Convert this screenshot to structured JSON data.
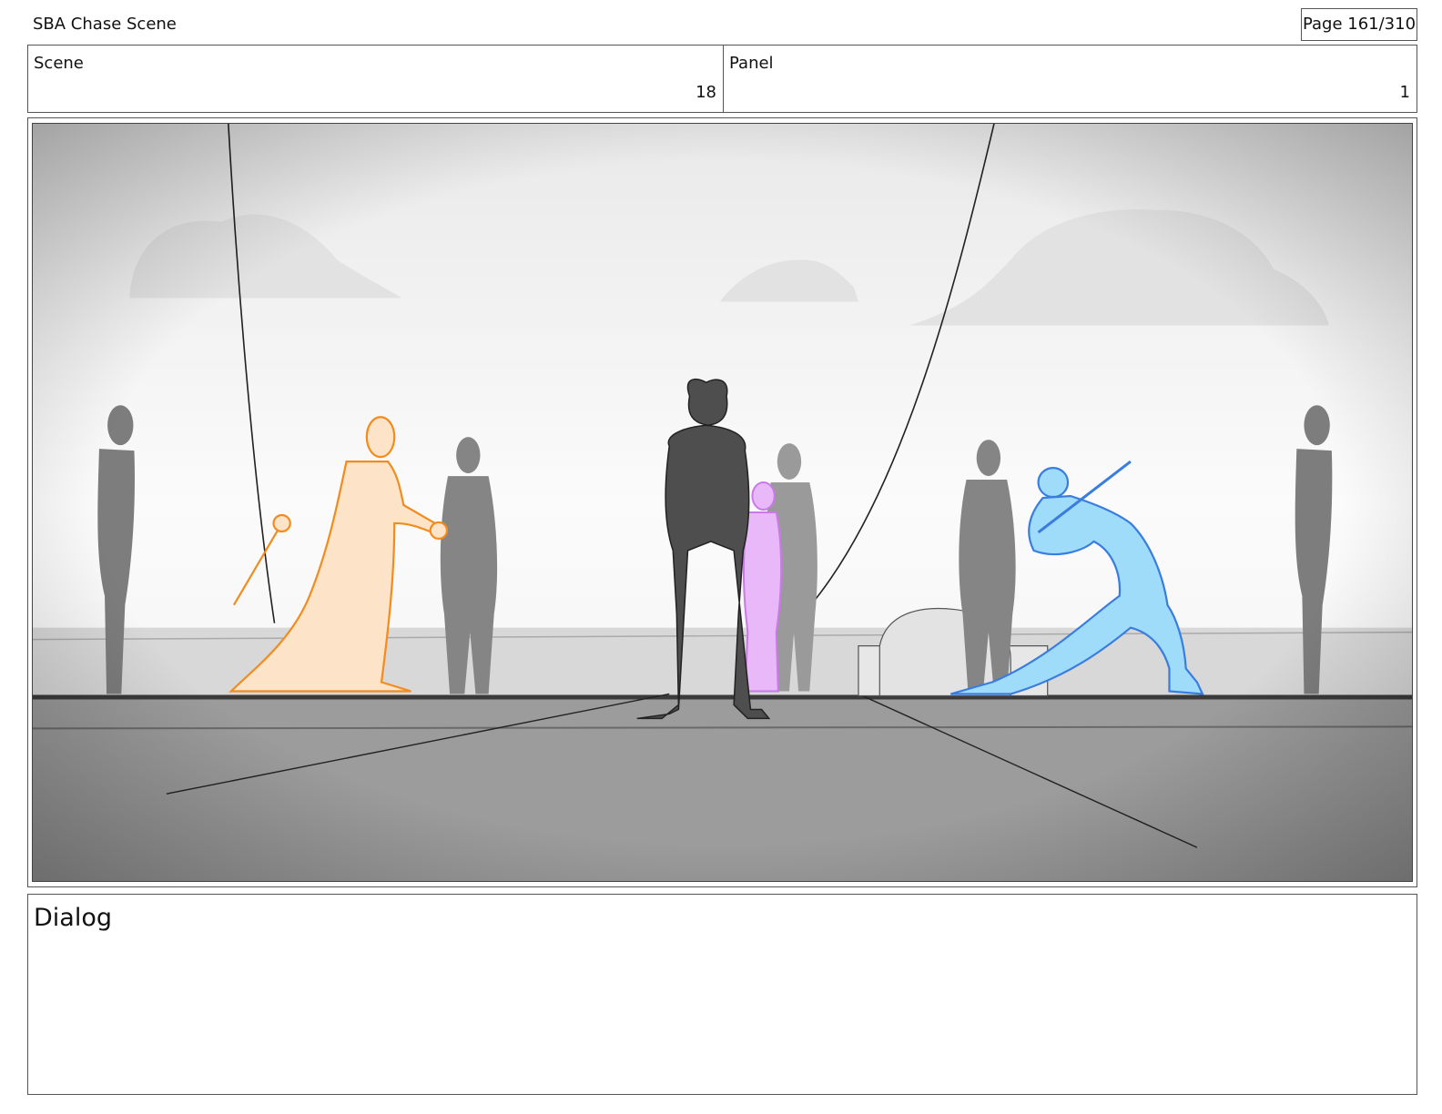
{
  "header": {
    "title": "SBA Chase Scene",
    "page": "Page 161/310"
  },
  "info": {
    "scene_label": "Scene",
    "scene_value": "18",
    "panel_label": "Panel",
    "panel_value": "1"
  },
  "dialog": {
    "label": "Dialog"
  },
  "colors": {
    "orange_character": "#f28c1e",
    "purple_character": "#c97ae8",
    "blue_character": "#3a7de0",
    "blue_fill": "#8fd0f5",
    "grey_figure": "#7a7a7a",
    "dark_figure": "#4a4a4a"
  }
}
